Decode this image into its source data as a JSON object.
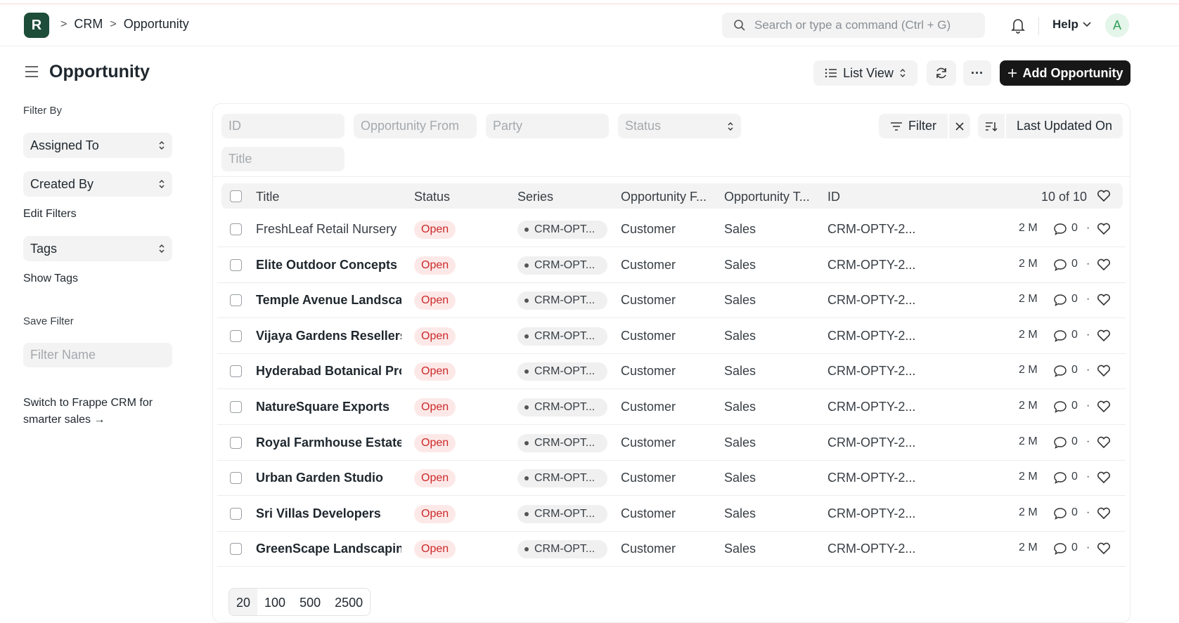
{
  "navbar": {
    "logo_letter": "R",
    "breadcrumbs": [
      "CRM",
      "Opportunity"
    ],
    "search_placeholder": "Search or type a command (Ctrl + G)",
    "help_label": "Help",
    "avatar_letter": "A"
  },
  "page": {
    "title": "Opportunity",
    "view_label": "List View",
    "add_label": "Add Opportunity",
    "more_label": "···"
  },
  "sidebar": {
    "filter_by": "Filter By",
    "assigned_to": "Assigned To",
    "created_by": "Created By",
    "edit_filters": "Edit Filters",
    "tags": "Tags",
    "show_tags": "Show Tags",
    "save_filter": "Save Filter",
    "filter_name_placeholder": "Filter Name",
    "promo": "Switch to Frappe CRM for smarter sales →"
  },
  "filters": {
    "id_placeholder": "ID",
    "opportunity_from_placeholder": "Opportunity From",
    "party_placeholder": "Party",
    "status_placeholder": "Status",
    "title_placeholder": "Title",
    "filter_label": "Filter",
    "sort_label": "Last Updated On"
  },
  "table": {
    "columns": [
      "Title",
      "Status",
      "Series",
      "Opportunity F...",
      "Opportunity T...",
      "ID"
    ],
    "count": "10 of 10",
    "rows": [
      {
        "title": "FreshLeaf Retail Nursery",
        "status": "Open",
        "series": "CRM-OPT...",
        "from": "Customer",
        "type": "Sales",
        "id": "CRM-OPTY-2...",
        "modified": "2 M",
        "comments": "0",
        "bold": false
      },
      {
        "title": "Elite Outdoor Concepts",
        "status": "Open",
        "series": "CRM-OPT...",
        "from": "Customer",
        "type": "Sales",
        "id": "CRM-OPTY-2...",
        "modified": "2 M",
        "comments": "0",
        "bold": true
      },
      {
        "title": "Temple Avenue Landscapes",
        "status": "Open",
        "series": "CRM-OPT...",
        "from": "Customer",
        "type": "Sales",
        "id": "CRM-OPTY-2...",
        "modified": "2 M",
        "comments": "0",
        "bold": true
      },
      {
        "title": "Vijaya Gardens Resellers",
        "status": "Open",
        "series": "CRM-OPT...",
        "from": "Customer",
        "type": "Sales",
        "id": "CRM-OPTY-2...",
        "modified": "2 M",
        "comments": "0",
        "bold": true
      },
      {
        "title": "Hyderabad Botanical Products",
        "status": "Open",
        "series": "CRM-OPT...",
        "from": "Customer",
        "type": "Sales",
        "id": "CRM-OPTY-2...",
        "modified": "2 M",
        "comments": "0",
        "bold": true
      },
      {
        "title": "NatureSquare Exports",
        "status": "Open",
        "series": "CRM-OPT...",
        "from": "Customer",
        "type": "Sales",
        "id": "CRM-OPTY-2...",
        "modified": "2 M",
        "comments": "0",
        "bold": true
      },
      {
        "title": "Royal Farmhouse Estates",
        "status": "Open",
        "series": "CRM-OPT...",
        "from": "Customer",
        "type": "Sales",
        "id": "CRM-OPTY-2...",
        "modified": "2 M",
        "comments": "0",
        "bold": true
      },
      {
        "title": "Urban Garden Studio",
        "status": "Open",
        "series": "CRM-OPT...",
        "from": "Customer",
        "type": "Sales",
        "id": "CRM-OPTY-2...",
        "modified": "2 M",
        "comments": "0",
        "bold": true
      },
      {
        "title": "Sri Villas Developers",
        "status": "Open",
        "series": "CRM-OPT...",
        "from": "Customer",
        "type": "Sales",
        "id": "CRM-OPTY-2...",
        "modified": "2 M",
        "comments": "0",
        "bold": true
      },
      {
        "title": "GreenScape Landscaping",
        "status": "Open",
        "series": "CRM-OPT...",
        "from": "Customer",
        "type": "Sales",
        "id": "CRM-OPTY-2...",
        "modified": "2 M",
        "comments": "0",
        "bold": true
      }
    ]
  },
  "pager": {
    "sizes": [
      "20",
      "100",
      "500",
      "2500"
    ],
    "active": "20"
  },
  "icons": {
    "search": "search-icon",
    "bell": "bell-icon",
    "chevron": "chevron-down-icon",
    "hamburger": "hamburger-icon",
    "list": "list-icon",
    "refresh": "refresh-icon",
    "plus": "plus-icon",
    "filter": "filter-icon",
    "close": "close-icon",
    "sort": "sort-icon",
    "comment": "comment-icon",
    "heart": "heart-icon",
    "updown": "select-arrows-icon"
  },
  "colors": {
    "primary_button": "#171717",
    "status_open_bg": "#fde8e8",
    "status_open_text": "#cc2929",
    "logo_bg": "#1e4d3a"
  }
}
